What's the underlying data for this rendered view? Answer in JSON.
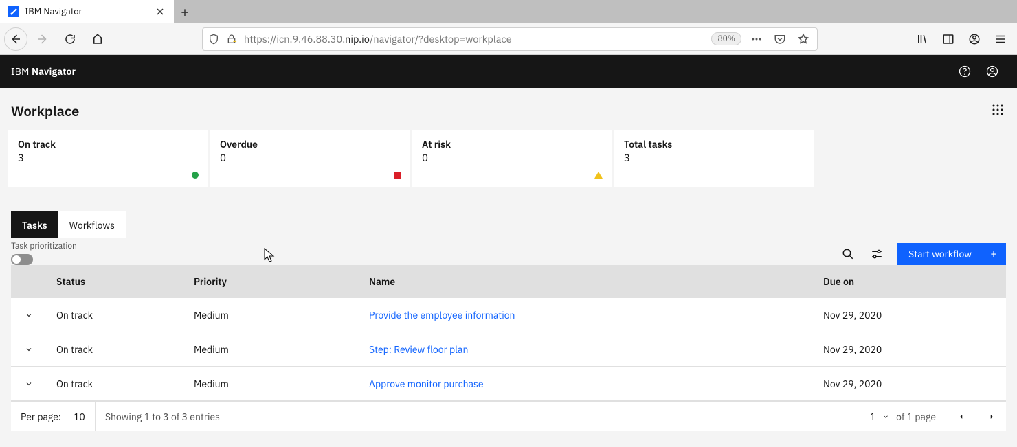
{
  "browser": {
    "tab_title": "IBM Navigator",
    "url_prefix": "https://",
    "url_mid1": "icn.9.46.88.30.",
    "url_host": "nip.io",
    "url_rest": "/navigator/?desktop=workplace",
    "zoom": "80%"
  },
  "header": {
    "brand_prefix": "IBM ",
    "brand_strong": "Navigator"
  },
  "page": {
    "title": "Workplace"
  },
  "summary": {
    "on_track_label": "On track",
    "on_track_count": "3",
    "overdue_label": "Overdue",
    "overdue_count": "0",
    "at_risk_label": "At risk",
    "at_risk_count": "0",
    "total_label": "Total tasks",
    "total_count": "3"
  },
  "tabs": {
    "tasks": "Tasks",
    "workflows": "Workflows"
  },
  "prio_label": "Task prioritization",
  "start_workflow": "Start workflow",
  "columns": {
    "status": "Status",
    "priority": "Priority",
    "name": "Name",
    "due": "Due on"
  },
  "rows": [
    {
      "status": "On track",
      "priority": "Medium",
      "name": "Provide the employee information",
      "due": "Nov 29, 2020"
    },
    {
      "status": "On track",
      "priority": "Medium",
      "name": "Step: Review floor plan",
      "due": "Nov 29, 2020"
    },
    {
      "status": "On track",
      "priority": "Medium",
      "name": "Approve monitor purchase",
      "due": "Nov 29, 2020"
    }
  ],
  "footer": {
    "per_page_label": "Per page:",
    "per_page_value": "10",
    "showing": "Showing 1 to 3 of 3 entries",
    "page_current": "1",
    "page_of": "of 1 page"
  }
}
